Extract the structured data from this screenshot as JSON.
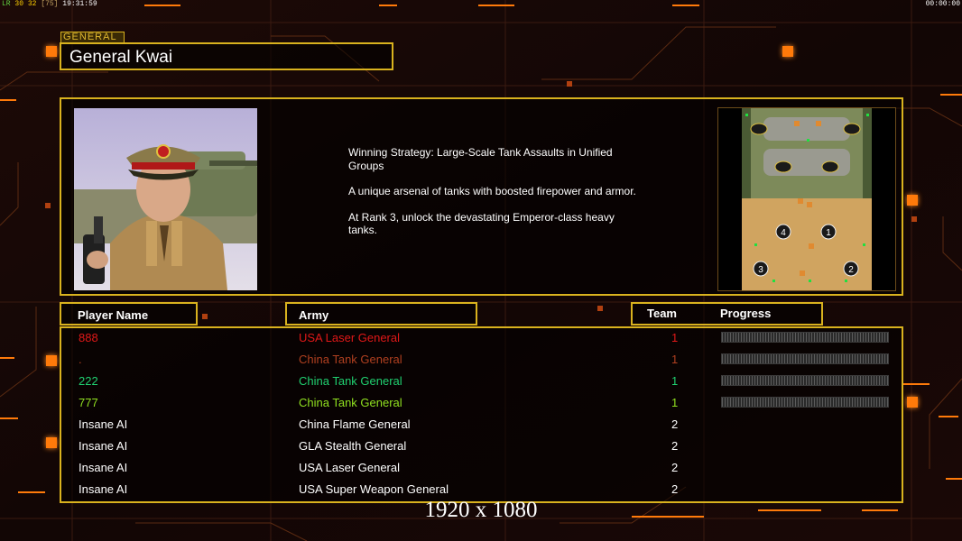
{
  "status_bar": {
    "left": [
      "LR",
      "30",
      "32",
      "[75]",
      "19:31:59"
    ],
    "right": "00:00:00"
  },
  "general_tag": "GENERAL",
  "general_name": "General Kwai",
  "strategy": [
    "Winning Strategy: Large-Scale Tank Assaults in Unified Groups",
    "A unique arsenal of tanks with boosted firepower and armor.",
    "At Rank 3, unlock the devastating Emperor-class heavy tanks."
  ],
  "minimap": {
    "start_positions": [
      "1",
      "2",
      "3",
      "4"
    ]
  },
  "headers": {
    "player_name": "Player Name",
    "army": "Army",
    "team": "Team",
    "progress": "Progress"
  },
  "players": [
    {
      "name": "888",
      "army": "USA Laser General",
      "team": "1",
      "color": "#e01818",
      "has_progress": true
    },
    {
      "name": ".",
      "army": "China Tank General",
      "team": "1",
      "color": "#b04020",
      "has_progress": true
    },
    {
      "name": "222",
      "army": "China Tank General",
      "team": "1",
      "color": "#20d070",
      "has_progress": true
    },
    {
      "name": "777",
      "army": "China Tank General",
      "team": "1",
      "color": "#90e020",
      "has_progress": true
    },
    {
      "name": "Insane AI",
      "army": "China Flame General",
      "team": "2",
      "color": "#ffffff",
      "has_progress": false
    },
    {
      "name": "Insane AI",
      "army": "GLA Stealth General",
      "team": "2",
      "color": "#ffffff",
      "has_progress": false
    },
    {
      "name": "Insane AI",
      "army": "USA Laser General",
      "team": "2",
      "color": "#ffffff",
      "has_progress": false
    },
    {
      "name": "Insane AI",
      "army": "USA Super Weapon General",
      "team": "2",
      "color": "#ffffff",
      "has_progress": false
    }
  ],
  "resolution_label": "1920 x 1080",
  "colors": {
    "accent": "#d9b21e",
    "glow": "#ff7a0a"
  }
}
